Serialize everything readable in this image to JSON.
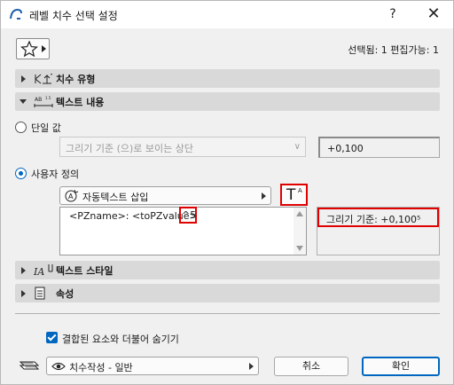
{
  "window": {
    "title": "레벨 치수 선택 설정",
    "help_label": "?",
    "close_label": "✕"
  },
  "header": {
    "favorites_icon": "star-icon",
    "selection_status": "선택됨: 1 편집가능: 1"
  },
  "sections": {
    "dimension_type": {
      "label": "치수 유형",
      "icon": "level-dimension-icon",
      "expanded": false
    },
    "text_content": {
      "label": "텍스트 내용",
      "icon": "text-content-icon",
      "expanded": true
    },
    "text_style": {
      "label": "텍스트 스타일",
      "icon": "text-style-icon",
      "expanded": false
    },
    "properties": {
      "label": "속성",
      "icon": "properties-icon",
      "expanded": false
    }
  },
  "text_content": {
    "single_value": {
      "label": "단일 값",
      "selected": false,
      "dropdown_value": "그리기 기준 (으)로 보이는 상단",
      "value": "+0,100"
    },
    "custom": {
      "label": "사용자 정의",
      "selected": true,
      "autotext_label": "자동텍스트 삽입",
      "style_button_t": "T",
      "style_button_a": "A",
      "text_value": "<PZname>: <toPZvalue>",
      "text_highlight": "^5",
      "preview": "그리기 기준: +0,100⁵"
    }
  },
  "footer": {
    "hide_checkbox_label": "결합된 요소와 더불어 숨기기",
    "hide_checkbox_checked": true,
    "layer_value": "치수작성 - 일반",
    "cancel_label": "취소",
    "ok_label": "확인"
  },
  "colors": {
    "accent": "#0067c0",
    "annotation_red": "#e00000",
    "section_bg": "#d9d9d9",
    "dialog_bg": "#f0f0f0"
  }
}
